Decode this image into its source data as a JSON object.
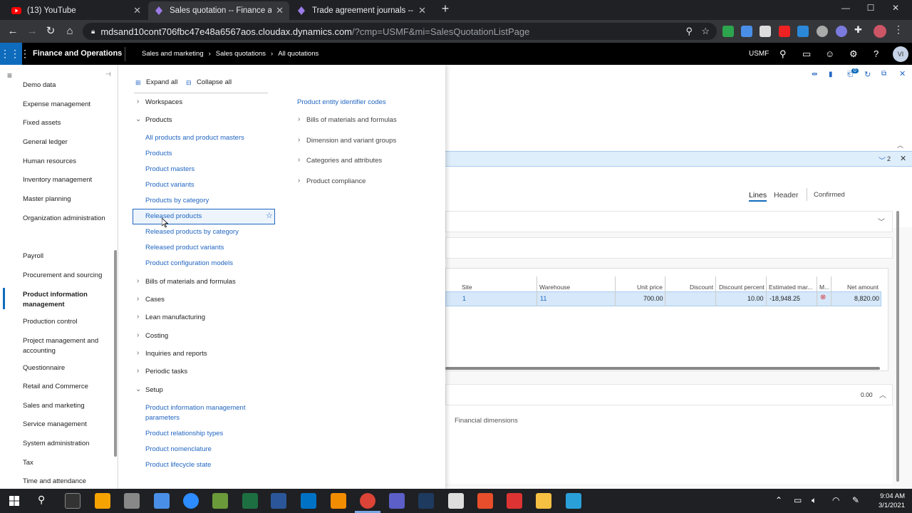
{
  "browser": {
    "tabs": [
      {
        "title": "(13) YouTube"
      },
      {
        "title": "Sales quotation -- Finance and C"
      },
      {
        "title": "Trade agreement journals -- Fina"
      }
    ],
    "url_host": "mdsand10cont706fbc47e48a6567aos.cloudax.dynamics.com",
    "url_path": "/?cmp=USMF&mi=SalesQuotationListPage"
  },
  "app": {
    "name": "Finance and Operations",
    "breadcrumb": [
      "Sales and marketing",
      "Sales quotations",
      "All quotations"
    ],
    "company": "USMF",
    "user_initials": "VI"
  },
  "left_nav": {
    "items": [
      "Demo data",
      "Expense management",
      "Fixed assets",
      "General ledger",
      "Human resources",
      "Inventory management",
      "Master planning",
      "Organization administration",
      "Payroll",
      "Procurement and sourcing",
      "Product information management",
      "Production control",
      "Project management and accounting",
      "Questionnaire",
      "Retail and Commerce",
      "Sales and marketing",
      "Service management",
      "System administration",
      "Tax",
      "Time and attendance"
    ],
    "selected": "Product information management"
  },
  "flyout": {
    "expand_all": "Expand all",
    "collapse_all": "Collapse all",
    "groups": {
      "workspaces": "Workspaces",
      "products": "Products",
      "bom": "Bills of materials and formulas",
      "cases": "Cases",
      "lean": "Lean manufacturing",
      "costing": "Costing",
      "inquiries": "Inquiries and reports",
      "periodic": "Periodic tasks",
      "setup": "Setup"
    },
    "product_links": [
      "All products and product masters",
      "Products",
      "Product masters",
      "Product variants",
      "Products by category",
      "Released products",
      "Released products by category",
      "Released product variants",
      "Product configuration models"
    ],
    "setup_links": [
      "Product information management parameters",
      "Product relationship types",
      "Product nomenclature",
      "Product lifecycle state"
    ],
    "right_col": {
      "link": "Product entity identifier codes",
      "groups": [
        "Bills of materials and formulas",
        "Dimension and variant groups",
        "Categories and attributes",
        "Product compliance"
      ]
    }
  },
  "form": {
    "notif_count": "0",
    "msg_count": "2",
    "tabs": {
      "lines": "Lines",
      "header": "Header"
    },
    "status": "Confirmed",
    "columns": {
      "site": "Site",
      "warehouse": "Warehouse",
      "unit_price": "Unit price",
      "discount": "Discount",
      "discount_percent": "Discount percent",
      "estimated_margin": "Estimated mar...",
      "m": "M...",
      "net_amount": "Net amount"
    },
    "row": {
      "site": "1",
      "warehouse": "11",
      "unit_price": "700.00",
      "discount_percent": "10.00",
      "estimated_margin": "-18,948.25",
      "net_amount": "8,820.00"
    },
    "footer_total": "0.00",
    "financial_dimensions": "Financial dimensions"
  },
  "taskbar": {
    "time": "9:04 AM",
    "date": "3/1/2021"
  }
}
